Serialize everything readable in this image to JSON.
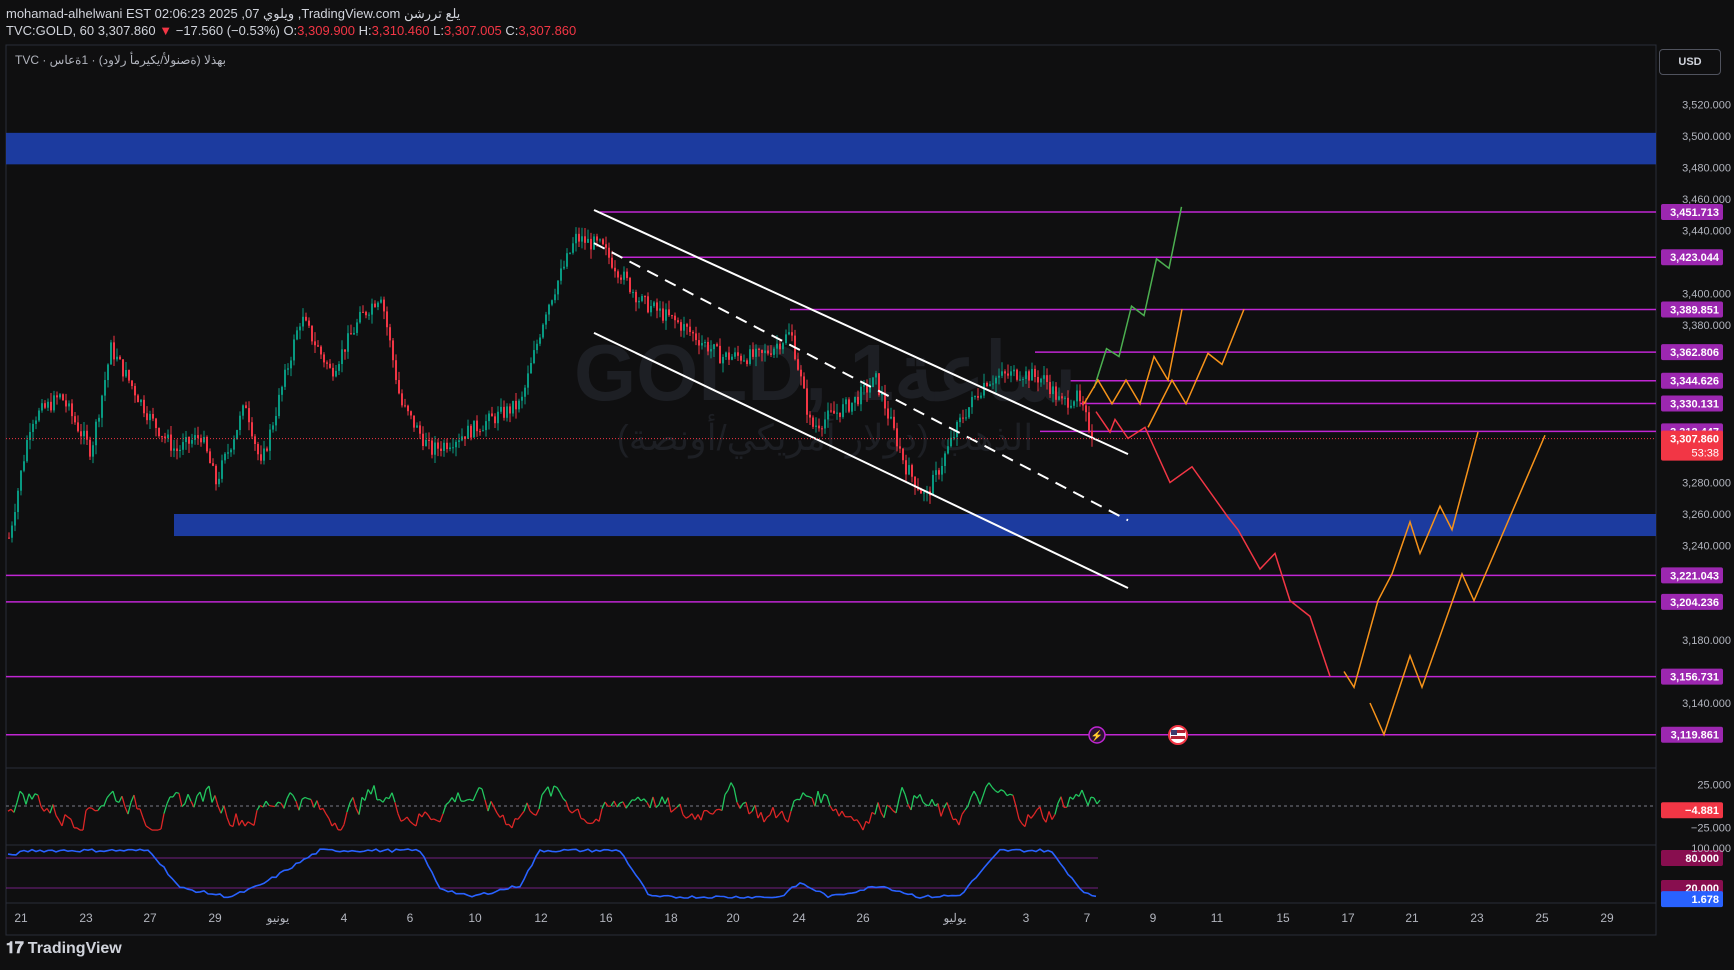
{
  "header": {
    "line1": "mohamad-alhelwani EST 02:06:23 2025 ,07 ويلوي ,TradingView.com يلع تررشن",
    "symbol": "TVC:GOLD, 60",
    "last": "3,307.860",
    "change": "−17.560 (−0.53%)",
    "o_label": "O:",
    "o": "3,309.900",
    "h_label": "H:",
    "h": "3,310.460",
    "l_label": "L:",
    "l": "3,307.005",
    "c_label": "C:",
    "c": "3,307.860"
  },
  "legend": "TVC · بهذلا (ةصنولأ/يكيرمأ رلاود) · 1ةعاس",
  "watermark": {
    "symbol": "GOLD, 1ساعة",
    "subtitle": "الذهب (دولار أمريكي/أونصة)"
  },
  "currency_button": "USD",
  "footer_logo": "TradingView",
  "colors": {
    "background": "#0f0f10",
    "up": "#089981",
    "down": "#f23645",
    "level_line": "#c026d3",
    "level_label": "#9c27b0",
    "zone": "#1e40af",
    "last_price": "#f23645",
    "projection_green": "#4caf50",
    "projection_orange": "#f7931a",
    "projection_red": "#f23645",
    "oscillator_line": "#2962ff"
  },
  "chart_data": [
    {
      "type": "candlestick",
      "price_axis": {
        "ticks": [
          "3,520.000",
          "3,500.000",
          "3,480.000",
          "3,460.000",
          "3,440.000",
          "3,400.000",
          "3,380.000",
          "3,280.000",
          "3,260.000",
          "3,240.000",
          "3,180.000",
          "3,140.000"
        ],
        "range": [
          3110,
          3540
        ]
      },
      "time_axis": {
        "ticks": [
          "21",
          "23",
          "27",
          "29",
          "يونيو",
          "4",
          "6",
          "10",
          "12",
          "16",
          "18",
          "20",
          "24",
          "26",
          "يوليو",
          "3",
          "7",
          "9",
          "11",
          "15",
          "17",
          "21",
          "23",
          "25",
          "29"
        ]
      },
      "horizontal_levels": [
        {
          "price": 3451.713,
          "label": "3,451.713"
        },
        {
          "price": 3423.044,
          "label": "3,423.044"
        },
        {
          "price": 3389.851,
          "label": "3,389.851"
        },
        {
          "price": 3362.806,
          "label": "3,362.806"
        },
        {
          "price": 3344.626,
          "label": "3,344.626"
        },
        {
          "price": 3330.131,
          "label": "3,330.131"
        },
        {
          "price": 3312.447,
          "label": "3,312.447"
        },
        {
          "price": 3221.043,
          "label": "3,221.043"
        },
        {
          "price": 3204.236,
          "label": "3,204.236"
        },
        {
          "price": 3156.731,
          "label": "3,156.731"
        },
        {
          "price": 3119.861,
          "label": "3,119.861"
        }
      ],
      "zones": [
        {
          "from": 3482,
          "to": 3502
        },
        {
          "from": 3246,
          "to": 3260
        }
      ],
      "last_price": {
        "label": "3,307.860",
        "countdown": "53:38",
        "price": 3307.86
      },
      "channel": {
        "upper": [
          [
            "16",
            3453
          ],
          [
            "7",
            3298
          ]
        ],
        "mid": [
          [
            "16",
            3432
          ],
          [
            "7",
            3256
          ]
        ],
        "lower": [
          [
            "16",
            3375
          ],
          [
            "7",
            3213
          ]
        ]
      },
      "projections": {
        "green": [
          3340,
          3365,
          3360,
          3392,
          3386,
          3422,
          3416,
          3455
        ],
        "orange_a": [
          3330,
          3345,
          3330,
          3345,
          3330,
          3360,
          3345,
          3390
        ],
        "orange_b": [
          3315,
          3345,
          3330,
          3362,
          3355,
          3390
        ],
        "red": [
          3325,
          3312,
          3320,
          3308,
          3315,
          3280,
          3290,
          3258,
          3250,
          3225,
          3235,
          3205,
          3195,
          3157
        ],
        "orange_c": [
          3160,
          3150,
          3205,
          3222,
          3255,
          3235,
          3265,
          3250,
          3312
        ],
        "orange_d": [
          3140,
          3120,
          3170,
          3150,
          3222,
          3205,
          3310
        ]
      }
    },
    {
      "type": "line",
      "name": "",
      "ticks": [
        "25.000",
        "−25.000"
      ],
      "range": [
        -32,
        32
      ],
      "current": "−4.881"
    },
    {
      "type": "line",
      "name": "",
      "ticks": [
        "100.000"
      ],
      "levels": [
        "80.000",
        "20.000"
      ],
      "range": [
        0,
        100
      ],
      "current": "1.678"
    }
  ]
}
